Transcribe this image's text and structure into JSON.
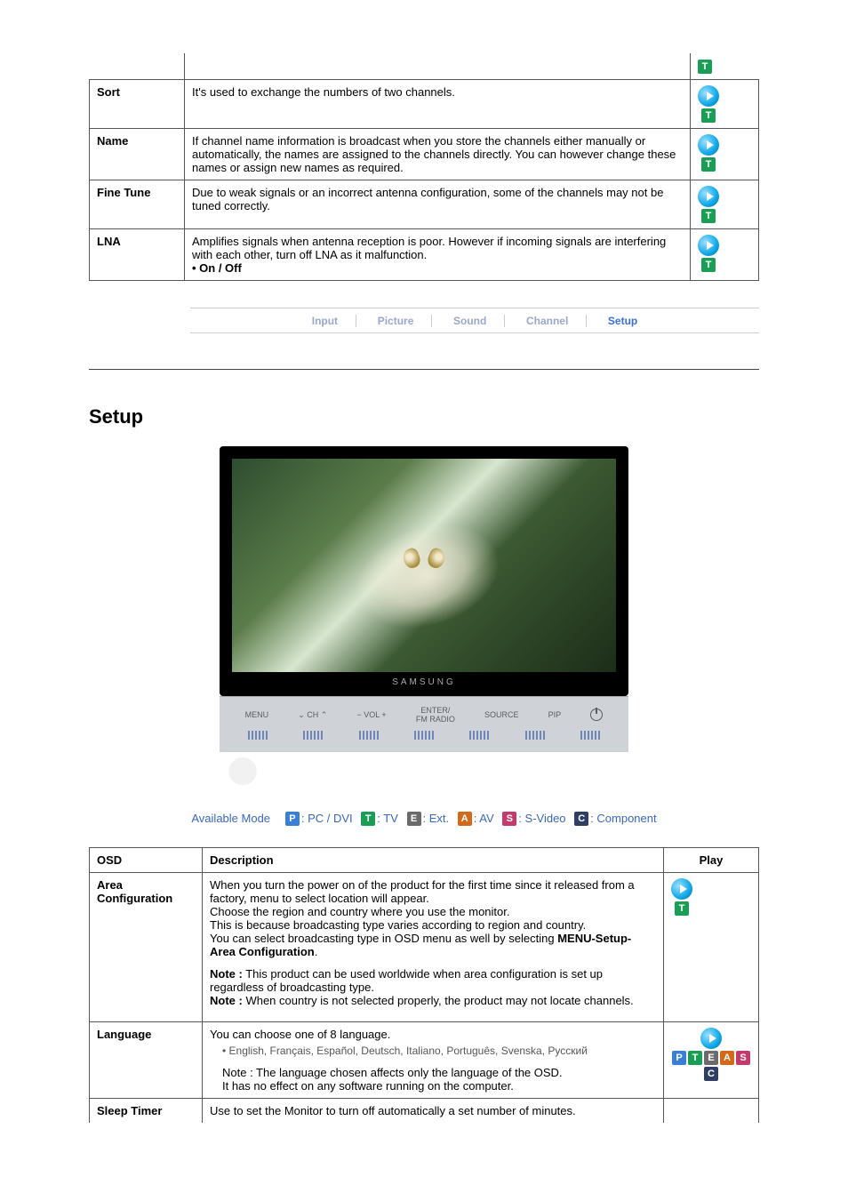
{
  "top_table": {
    "rows": [
      {
        "key": "sort",
        "label": "Sort",
        "desc": "It's used to exchange the numbers of two channels.",
        "modes": [
          "T"
        ]
      },
      {
        "key": "name",
        "label": "Name",
        "desc": "If channel name information is broadcast when you store the channels either manually or automatically, the names are assigned to the channels directly. You can however change these names or assign new names as required.",
        "modes": [
          "T"
        ]
      },
      {
        "key": "fine-tune",
        "label": "Fine Tune",
        "desc": "Due to weak signals or an incorrect antenna configuration, some of the channels may not be tuned correctly.",
        "modes": [
          "T"
        ]
      },
      {
        "key": "lna",
        "label": "LNA",
        "desc": "Amplifies signals when antenna reception is poor. However if incoming signals are interfering with each other, turn off LNA as it malfunction.",
        "options": "• On / Off",
        "modes": [
          "T"
        ]
      }
    ]
  },
  "tabs": [
    "Input",
    "Picture",
    "Sound",
    "Channel",
    "Setup"
  ],
  "active_tab": "Setup",
  "section_title": "Setup",
  "tv": {
    "brand": "SAMSUNG",
    "buttons": [
      "MENU",
      "⌄  CH  ⌃",
      "−  VOL  +",
      "ENTER/\nFM RADIO",
      "SOURCE",
      "PIP"
    ]
  },
  "legend": {
    "intro": "Available Mode",
    "items": [
      {
        "code": "P",
        "label": ": PC / DVI"
      },
      {
        "code": "T",
        "label": ": TV"
      },
      {
        "code": "E",
        "label": ": Ext."
      },
      {
        "code": "A",
        "label": ": AV"
      },
      {
        "code": "S",
        "label": ": S-Video"
      },
      {
        "code": "C",
        "label": ": Component"
      }
    ]
  },
  "setup_table": {
    "headers": {
      "osd": "OSD",
      "desc": "Description",
      "play": "Play"
    },
    "rows": [
      {
        "key": "area-configuration",
        "label": "Area Configuration",
        "desc_intro": "When you turn the power on of the product for the first time since it released from a factory, menu to select location will appear.\nChoose the region and country where you use the monitor.\nThis is because broadcasting type varies according to region and country.\nYou can select broadcasting type in OSD menu as well by selecting ",
        "desc_bold": "MENU-Setup-Area Configuration",
        "desc_bold_suffix": ".",
        "note1_label": "Note :",
        "note1": " This product can be used worldwide when area configuration is set up regardless of broadcasting type.",
        "note2_label": "Note :",
        "note2": " When country is not selected properly, the product may not locate channels.",
        "modes": [
          "T"
        ]
      },
      {
        "key": "language",
        "label": "Language",
        "line1": "You can choose one of 8 language.",
        "languages": "• English, Français, Español, Deutsch,  Italiano, Português, Svenska, Русский",
        "note": "Note : The language chosen affects only the language of the OSD.",
        "note_tail": "It has no effect on any software running on the computer.",
        "modes": [
          "P",
          "T",
          "E",
          "A",
          "S",
          "C"
        ]
      },
      {
        "key": "sleep-timer",
        "label": "Sleep Timer",
        "desc": "Use to set the Monitor to turn off automatically a set number of minutes.",
        "modes": []
      }
    ]
  }
}
